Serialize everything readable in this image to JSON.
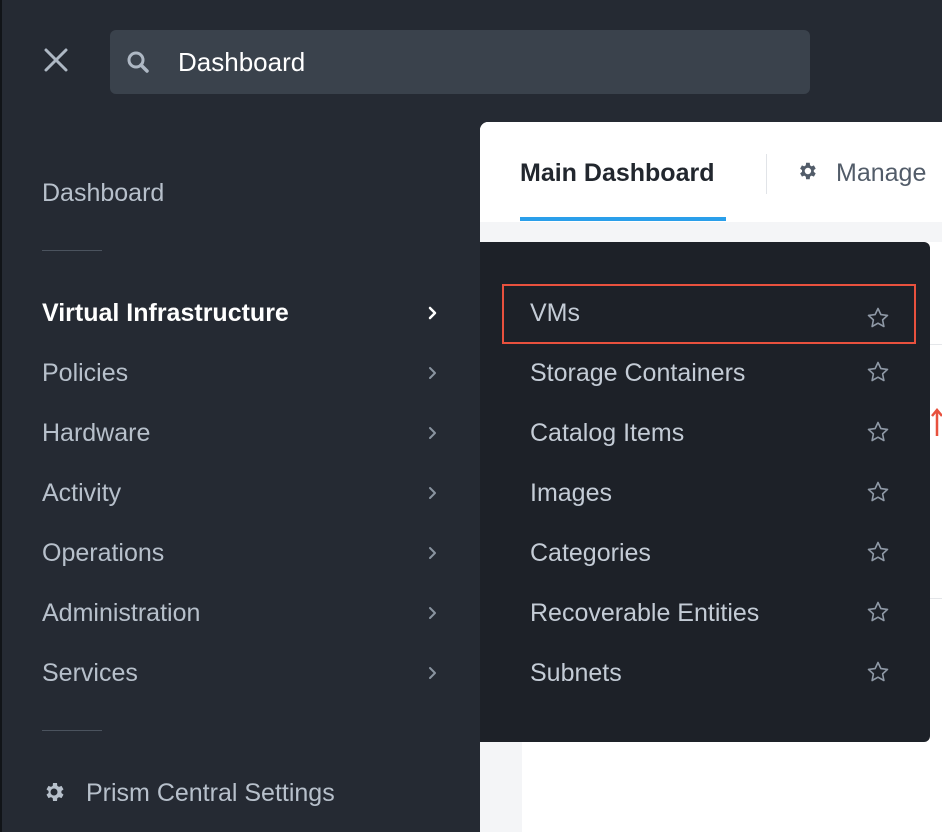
{
  "search": {
    "value": "Dashboard"
  },
  "sidebar": {
    "dashboard_label": "Dashboard",
    "items": [
      {
        "label": "Virtual Infrastructure",
        "active": true
      },
      {
        "label": "Policies"
      },
      {
        "label": "Hardware"
      },
      {
        "label": "Activity"
      },
      {
        "label": "Operations"
      },
      {
        "label": "Administration"
      },
      {
        "label": "Services"
      }
    ],
    "settings_label": "Prism Central Settings"
  },
  "main": {
    "tabs": [
      {
        "label": "Main Dashboard",
        "active": true
      },
      {
        "label": "Manage"
      }
    ]
  },
  "submenu": {
    "items": [
      {
        "label": "VMs",
        "highlighted": true
      },
      {
        "label": "Storage Containers"
      },
      {
        "label": "Catalog Items"
      },
      {
        "label": "Images"
      },
      {
        "label": "Categories"
      },
      {
        "label": "Recoverable Entities"
      },
      {
        "label": "Subnets"
      }
    ]
  },
  "colors": {
    "sidebar_bg": "#252a33",
    "flyout_bg": "#1d2128",
    "search_bg": "#3a424c",
    "tab_accent": "#2a9fea",
    "highlight_border": "#e8513e"
  },
  "icons": {
    "close": "close-icon",
    "search": "search-icon",
    "chevron": "chevron-right-icon",
    "star": "star-outline-icon",
    "settings": "gear-icon"
  }
}
